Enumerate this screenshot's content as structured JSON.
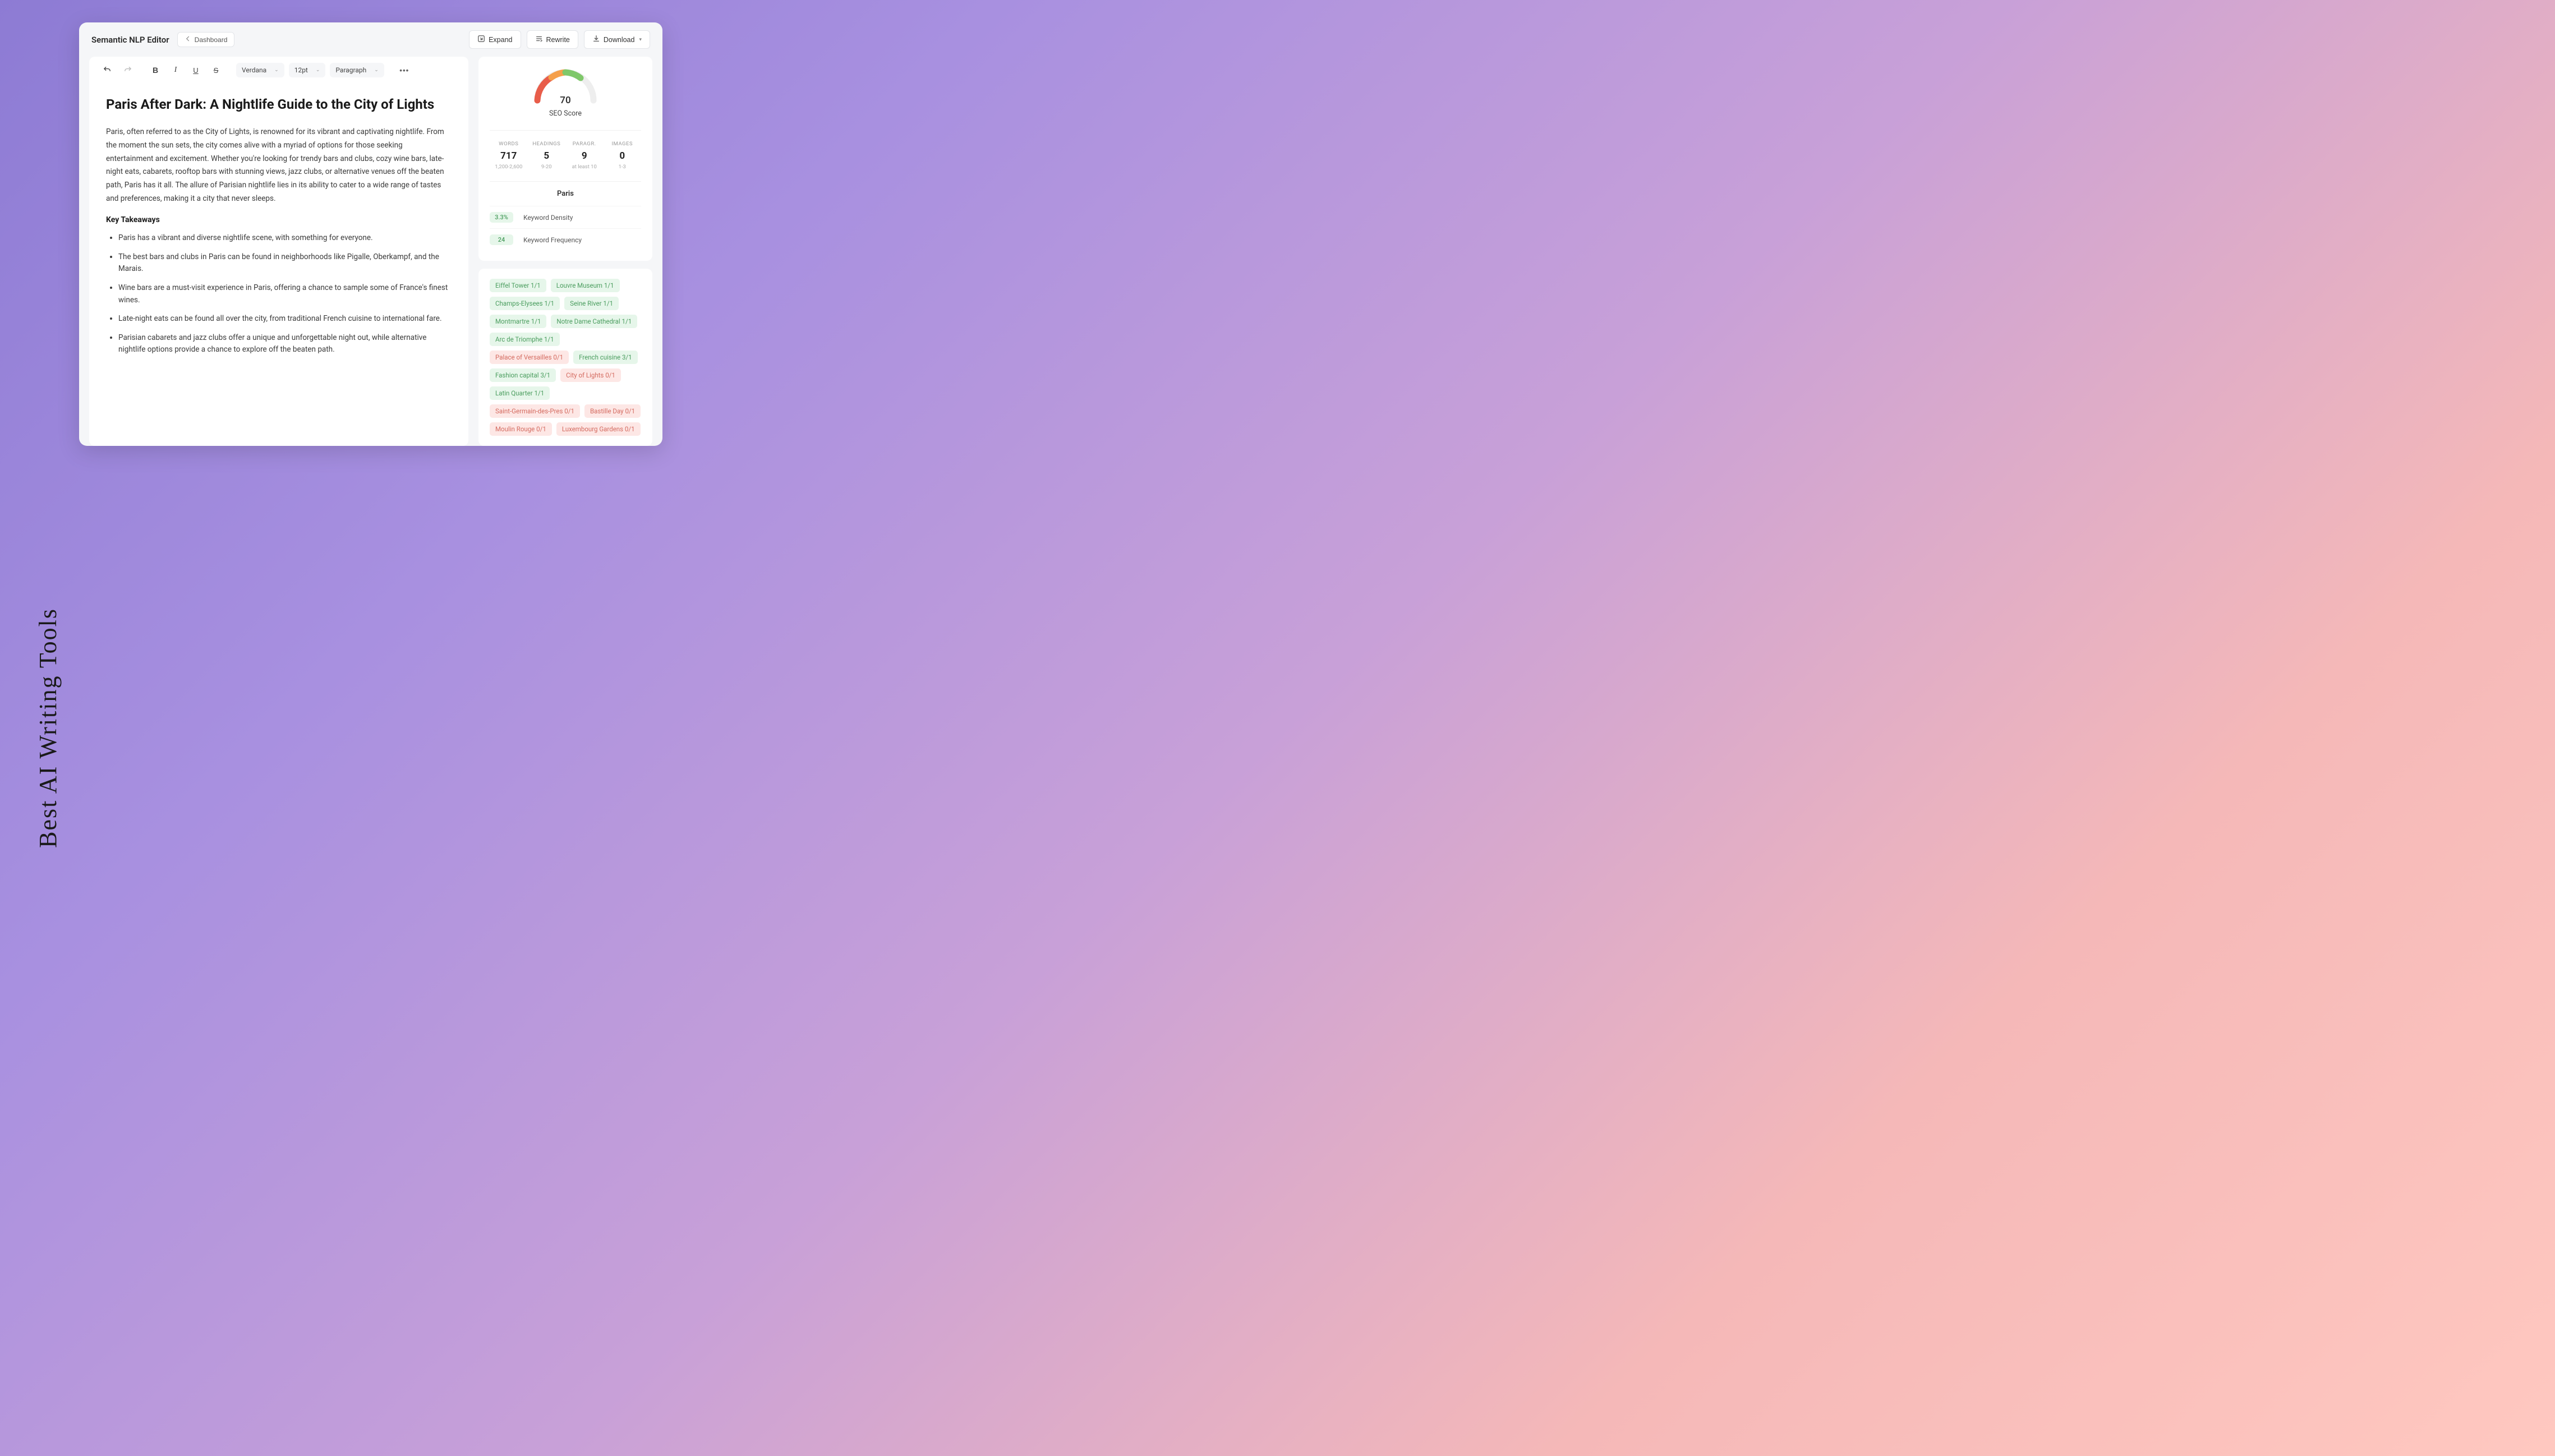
{
  "frame_label": "Best AI Writing Tools",
  "header": {
    "app_title": "Semantic NLP Editor",
    "dashboard_label": "Dashboard",
    "expand_label": "Expand",
    "rewrite_label": "Rewrite",
    "download_label": "Download"
  },
  "toolbar": {
    "font": "Verdana",
    "size": "12pt",
    "style": "Paragraph"
  },
  "document": {
    "title": "Paris After Dark: A Nightlife Guide to the City of Lights",
    "intro": "Paris, often referred to as the City of Lights, is renowned for its vibrant and captivating nightlife. From the moment the sun sets, the city comes alive with a myriad of options for those seeking entertainment and excitement. Whether you're looking for trendy bars and clubs, cozy wine bars, late-night eats, cabarets, rooftop bars with stunning views, jazz clubs, or alternative venues off the beaten path, Paris has it all. The allure of Parisian nightlife lies in its ability to cater to a wide range of tastes and preferences, making it a city that never sleeps.",
    "subhead": "Key Takeaways",
    "bullets": [
      "Paris has a vibrant and diverse nightlife scene, with something for everyone.",
      "The best bars and clubs in Paris can be found in neighborhoods like Pigalle, Oberkampf, and the Marais.",
      "Wine bars are a must-visit experience in Paris, offering a chance to sample some of France's finest wines.",
      "Late-night eats can be found all over the city, from traditional French cuisine to international fare.",
      "Parisian cabarets and jazz clubs offer a unique and unforgettable night out, while alternative nightlife options provide a chance to explore off the beaten path."
    ]
  },
  "seo": {
    "score": "70",
    "score_label": "SEO Score",
    "stats": [
      {
        "name": "WORDS",
        "value": "717",
        "hint": "1,200-2,600"
      },
      {
        "name": "HEADINGS",
        "value": "5",
        "hint": "9-20"
      },
      {
        "name": "PARAGR.",
        "value": "9",
        "hint": "at least 10"
      },
      {
        "name": "IMAGES",
        "value": "0",
        "hint": "1-3"
      }
    ],
    "keyword_title": "Paris",
    "density": {
      "value": "3.3%",
      "label": "Keyword Density"
    },
    "frequency": {
      "value": "24",
      "label": "Keyword Frequency"
    }
  },
  "chips": [
    {
      "text": "Eiffel Tower 1/1",
      "status": "ok"
    },
    {
      "text": "Louvre Museum 1/1",
      "status": "ok"
    },
    {
      "text": "Champs-Elysees 1/1",
      "status": "ok"
    },
    {
      "text": "Seine River 1/1",
      "status": "ok"
    },
    {
      "text": "Montmartre 1/1",
      "status": "ok"
    },
    {
      "text": "Notre Dame Cathedral 1/1",
      "status": "ok"
    },
    {
      "text": "Arc de Triomphe 1/1",
      "status": "ok"
    },
    {
      "text": "Palace of Versailles 0/1",
      "status": "bad"
    },
    {
      "text": "French cuisine 3/1",
      "status": "ok"
    },
    {
      "text": "Fashion capital 3/1",
      "status": "ok"
    },
    {
      "text": "City of Lights 0/1",
      "status": "bad"
    },
    {
      "text": "Latin Quarter 1/1",
      "status": "ok"
    },
    {
      "text": "Saint-Germain-des-Pres 0/1",
      "status": "bad"
    },
    {
      "text": "Bastille Day 0/1",
      "status": "bad"
    },
    {
      "text": "Moulin Rouge 0/1",
      "status": "bad"
    },
    {
      "text": "Luxembourg Gardens 0/1",
      "status": "bad"
    }
  ]
}
